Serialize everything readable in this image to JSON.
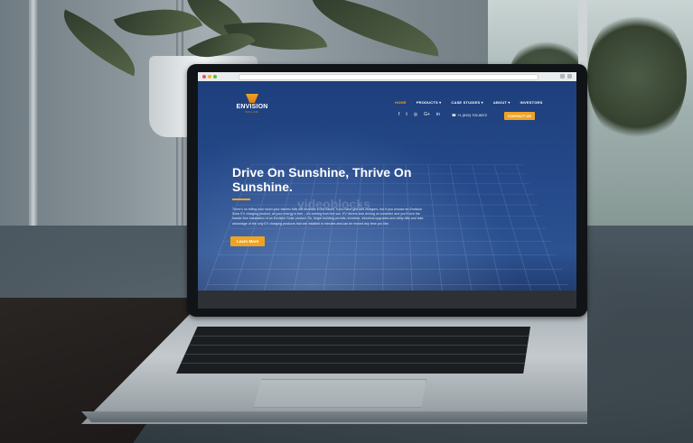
{
  "browser": {
    "dot_colors": [
      "#e9554a",
      "#f2b32b",
      "#55c03a"
    ]
  },
  "site": {
    "logo": {
      "name": "ENVISION",
      "tagline": "SOLAR"
    },
    "nav": [
      {
        "label": "HOME",
        "active": true
      },
      {
        "label": "PRODUCTS ▾",
        "active": false
      },
      {
        "label": "CASE STUDIES ▾",
        "active": false
      },
      {
        "label": "ABOUT ▾",
        "active": false
      },
      {
        "label": "INVESTORS",
        "active": false
      }
    ],
    "social_icons": [
      "facebook-icon",
      "twitter-icon",
      "instagram-icon",
      "google-plus-icon",
      "linkedin-icon"
    ],
    "phone": "+1 (619) 702-8672",
    "contact_button": "CONTACT US",
    "headline": "Drive On Sunshine, Thrive On Sunshine.",
    "body": "There's no telling how much your electric bills will increase in the future. If you have grid-tied chargers, but if you choose an Envision Solar EV charging product, all your energy is free – it's coming from the sun. EV drivers love driving on sunshine and you'll love the hassle-free installation of an Envision Solar product. So, forget building permits, trenches, electrical upgrades and utility bills and take advantage of the only EV charging products that are installed in minutes and can be moved any time you like.",
    "cta_button": "Learn More",
    "watermark": "videoblocks"
  },
  "colors": {
    "accent": "#f0a321",
    "site_background": "#1e3f7c"
  }
}
